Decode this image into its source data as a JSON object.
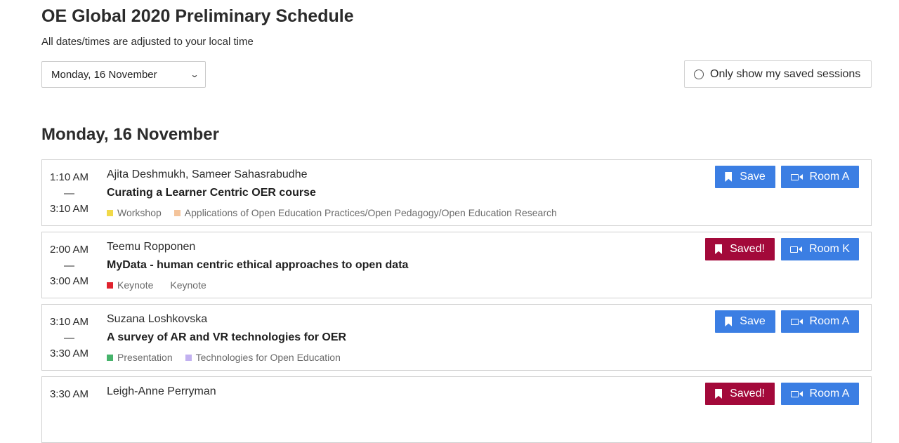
{
  "page": {
    "title": "OE Global 2020 Preliminary Schedule",
    "subtitle": "All dates/times are adjusted to your local time",
    "day_select": {
      "value": "Monday, 16 November"
    },
    "saved_filter": {
      "label": "Only show my saved sessions",
      "checked": false
    },
    "day_heading": "Monday, 16 November"
  },
  "colors": {
    "save_button": "#3b7ee3",
    "saved_button": "#a3093a",
    "room_button": "#3b7ee3"
  },
  "sessions": [
    {
      "start": "1:10 AM",
      "dash": "—",
      "end": "3:10 AM",
      "speakers": "Ajita Deshmukh, Sameer Sahasrabudhe",
      "title": "Curating a Learner Centric OER course",
      "type": {
        "label": "Workshop",
        "color": "#f1d949"
      },
      "track": {
        "label": "Applications of Open Education Practices/Open Pedagogy/Open Education Research",
        "color": "#f4c49b"
      },
      "save_label": "Save",
      "saved": false,
      "room_label": "Room A"
    },
    {
      "start": "2:00 AM",
      "dash": "—",
      "end": "3:00 AM",
      "speakers": "Teemu Ropponen",
      "title": "MyData - human centric ethical approaches to open data",
      "type": {
        "label": "Keynote",
        "color": "#e0232e"
      },
      "track": {
        "label": "Keynote",
        "color": ""
      },
      "save_label": "Saved!",
      "saved": true,
      "room_label": "Room K"
    },
    {
      "start": "3:10 AM",
      "dash": "—",
      "end": "3:30 AM",
      "speakers": "Suzana Loshkovska",
      "title": "A survey of AR and VR technologies for OER",
      "type": {
        "label": "Presentation",
        "color": "#46b36b"
      },
      "track": {
        "label": "Technologies for Open Education",
        "color": "#c2b1f0"
      },
      "save_label": "Save",
      "saved": false,
      "room_label": "Room A"
    },
    {
      "start": "3:30 AM",
      "speakers": "Leigh-Anne Perryman",
      "save_label": "Saved!",
      "saved": true,
      "room_label": "Room A"
    }
  ]
}
